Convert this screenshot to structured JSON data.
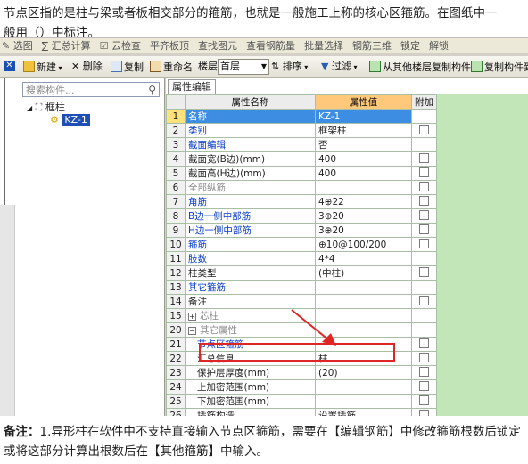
{
  "question": {
    "line1": "节点区指的是柱与梁或者板相交部分的箍筋，也就是一般施工上称的核心区箍筋。在图纸中一",
    "line2": "般用（）中标注。"
  },
  "top_toolbar": {
    "items": [
      "✎ 选图",
      "∑ 汇总计算",
      "☑ 云检查",
      "平齐板顶",
      "查找图元",
      "查看钢筋量",
      "批量选择",
      "钢筋三维",
      "锁定",
      "解锁"
    ]
  },
  "toolbar": {
    "new_label": "新建",
    "delete_label": "删除",
    "copy_label": "复制",
    "rename_label": "重命名",
    "floor_label": "楼层",
    "floor_value": "首层",
    "sort_label": "排序",
    "filter_label": "过滤",
    "copy_from_floor_label": "从其他楼层复制构件",
    "copy_to_label": "复制构件到"
  },
  "left_panel": {
    "search_placeholder": "搜索构件...",
    "tree_root": "框柱",
    "tree_child": "KZ-1"
  },
  "right_panel": {
    "tab_label": "属性编辑",
    "columns": {
      "name": "属性名称",
      "value": "属性值",
      "add": "附加"
    }
  },
  "rows": [
    {
      "num": "1",
      "name": "名称",
      "value": "KZ-1",
      "style": "blue",
      "checkbox": false,
      "selected": true
    },
    {
      "num": "2",
      "name": "类别",
      "value": "框架柱",
      "style": "blue",
      "checkbox": true
    },
    {
      "num": "3",
      "name": "截面编辑",
      "value": "否",
      "style": "blue",
      "checkbox": false
    },
    {
      "num": "4",
      "name": "截面宽(B边)(mm)",
      "value": "400",
      "style": "normal",
      "checkbox": true
    },
    {
      "num": "5",
      "name": "截面高(H边)(mm)",
      "value": "400",
      "style": "normal",
      "checkbox": true
    },
    {
      "num": "6",
      "name": "全部纵筋",
      "value": "",
      "style": "gray",
      "checkbox": true
    },
    {
      "num": "7",
      "name": "角筋",
      "value": "4⊕22",
      "style": "blue",
      "checkbox": true
    },
    {
      "num": "8",
      "name": "B边一侧中部筋",
      "value": "3⊕20",
      "style": "blue",
      "checkbox": true
    },
    {
      "num": "9",
      "name": "H边一侧中部筋",
      "value": "3⊕20",
      "style": "blue",
      "checkbox": true
    },
    {
      "num": "10",
      "name": "箍筋",
      "value": "⊕10@100/200",
      "style": "blue",
      "checkbox": true
    },
    {
      "num": "11",
      "name": "肢数",
      "value": "4*4",
      "style": "blue",
      "checkbox": false
    },
    {
      "num": "12",
      "name": "柱类型",
      "value": "(中柱)",
      "style": "normal",
      "checkbox": true
    },
    {
      "num": "13",
      "name": "其它箍筋",
      "value": "",
      "style": "blue",
      "checkbox": false
    },
    {
      "num": "14",
      "name": "备注",
      "value": "",
      "style": "normal",
      "checkbox": true
    },
    {
      "num": "15",
      "name": "芯柱",
      "value": "",
      "style": "gray-plus",
      "checkbox": false
    },
    {
      "num": "20",
      "name": "其它属性",
      "value": "",
      "style": "gray-minus",
      "checkbox": false
    },
    {
      "num": "21",
      "name": "节点区箍筋",
      "value": "",
      "style": "blue-sub",
      "checkbox": true
    },
    {
      "num": "22",
      "name": "汇总信息",
      "value": "柱",
      "style": "sub",
      "checkbox": true
    },
    {
      "num": "23",
      "name": "保护层厚度(mm)",
      "value": "(20)",
      "style": "sub",
      "checkbox": true
    },
    {
      "num": "24",
      "name": "上加密范围(mm)",
      "value": "",
      "style": "sub",
      "checkbox": true
    },
    {
      "num": "25",
      "name": "下加密范围(mm)",
      "value": "",
      "style": "sub",
      "checkbox": true
    },
    {
      "num": "26",
      "name": "插筋构造",
      "value": "设置插筋",
      "style": "sub",
      "checkbox": true
    }
  ],
  "note": {
    "prefix": "备注：",
    "text": "1.异形柱在软件中不支持直接输入节点区箍筋，需要在【编辑钢筋】中修改箍筋根数后锁定或将这部分计算出根数后在【其他箍筋】中输入。"
  },
  "colors": {
    "highlight": "#e02525",
    "grid_bg": "#c3e6b9",
    "value_header": "#ffc87a",
    "selected_row": "#3d8de3"
  }
}
